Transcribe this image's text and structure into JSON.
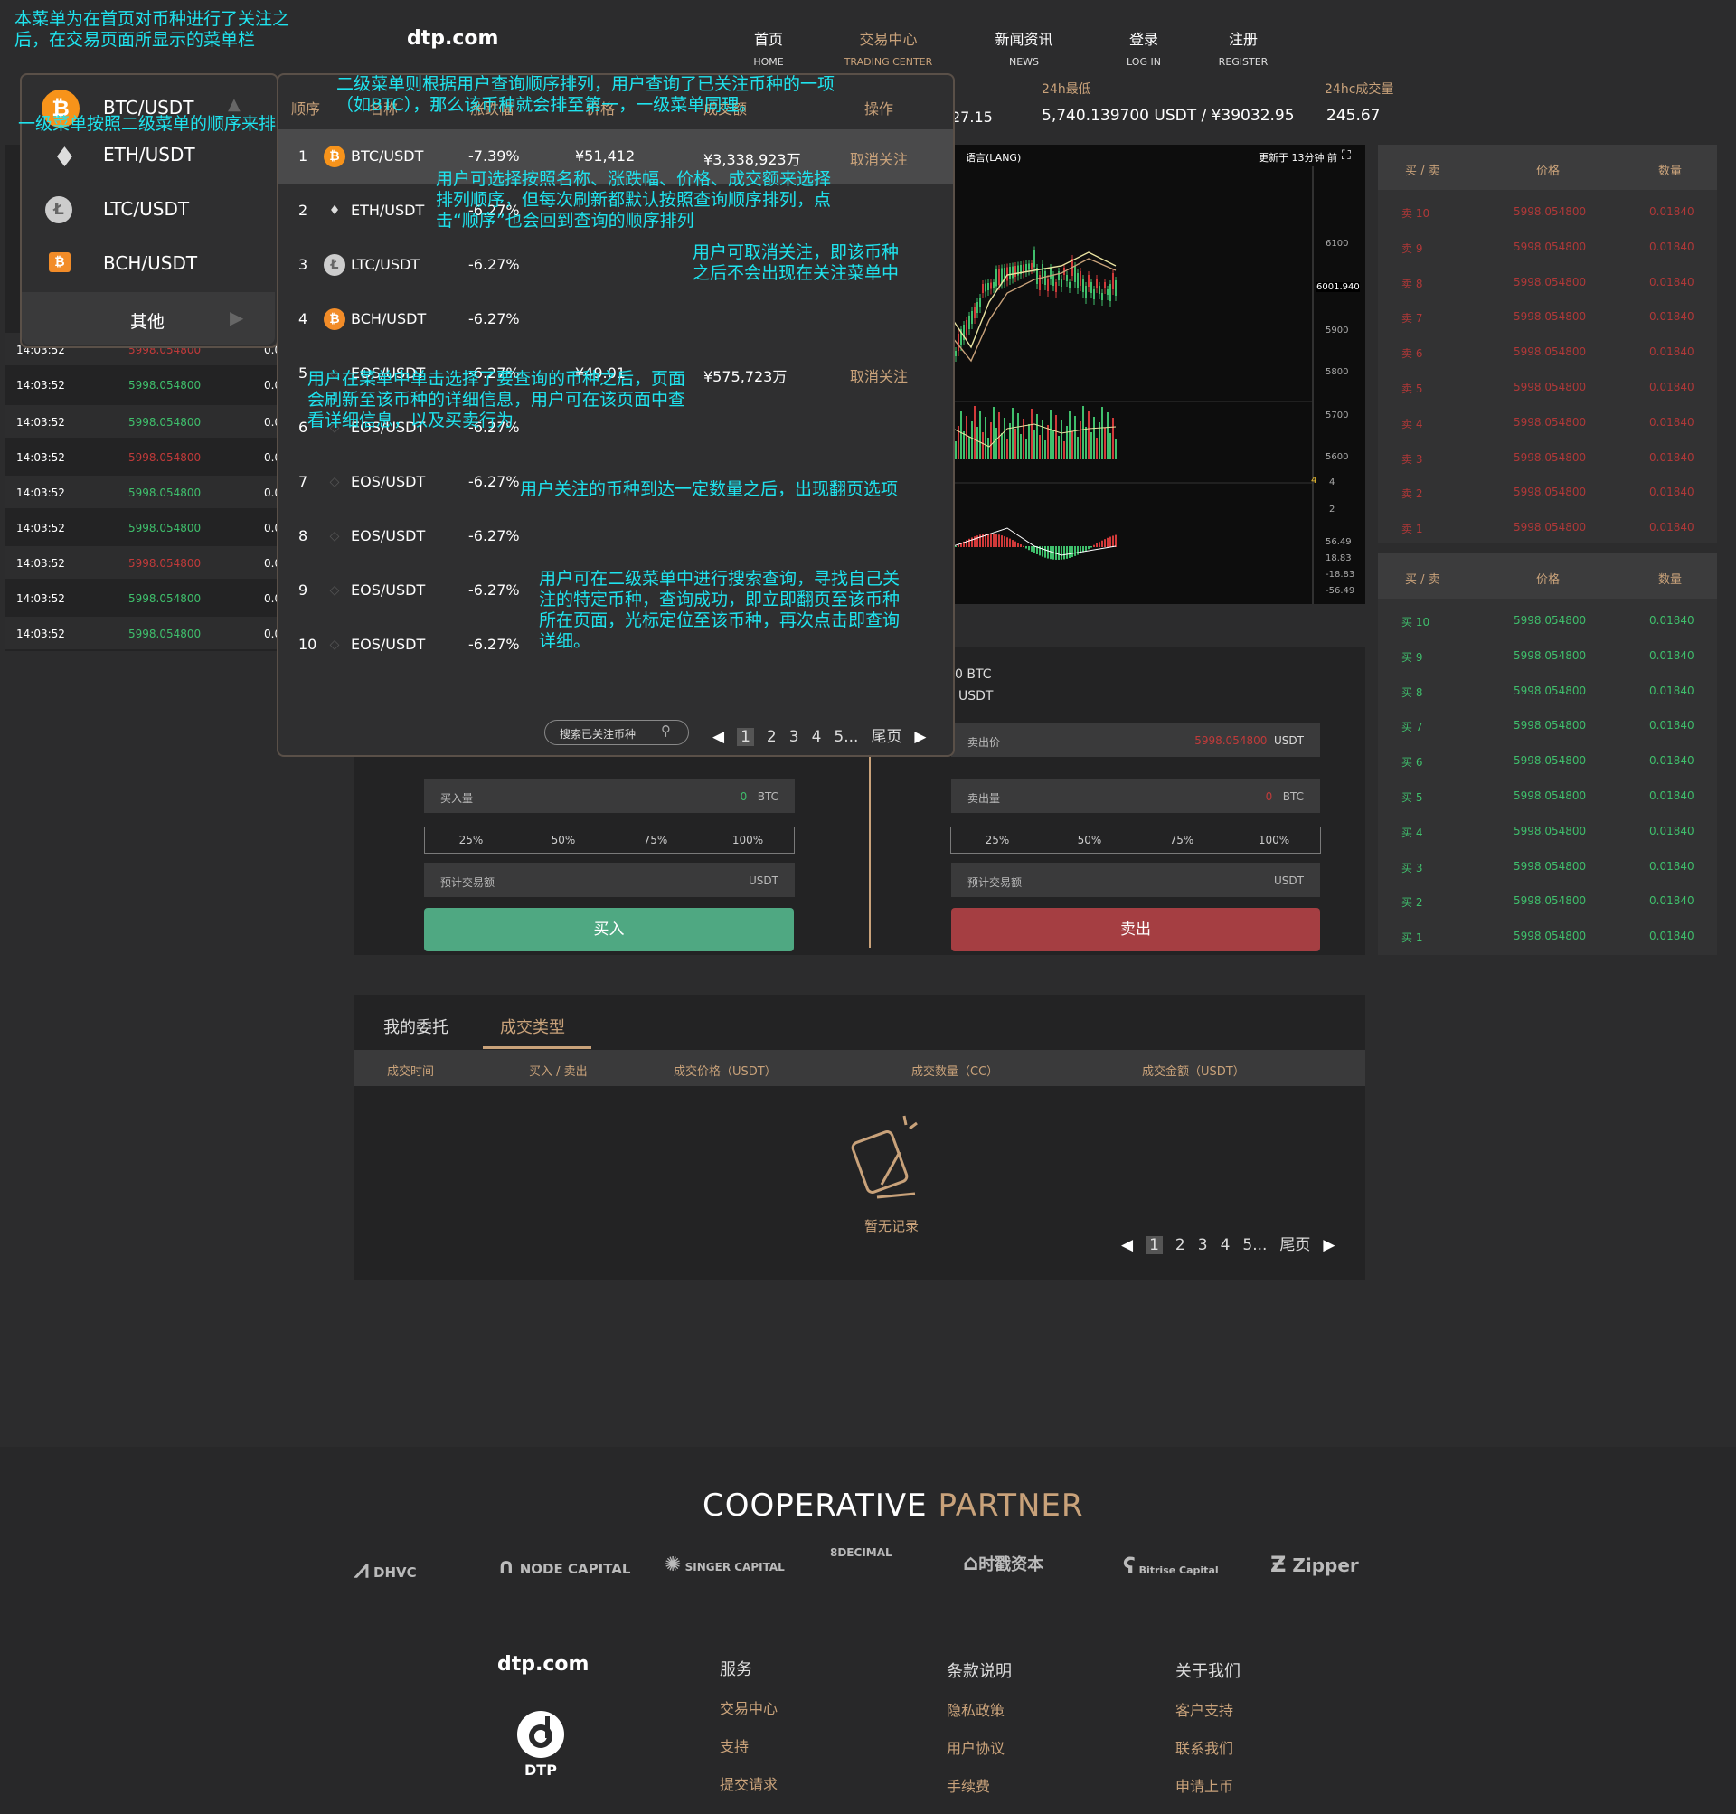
{
  "annotations": {
    "menu_intro": "本菜单为在首页对币种进行了关注之后，在交易页面所显示的菜单栏",
    "level1_order": "一级菜单按照二级菜单的顺序来排",
    "level2_order": "二级菜单则根据用户查询顺序排列，用户查询了已关注币种的一项（如BTC），那么该币种就会排至第一，一级菜单同理。",
    "sort_options": "用户可选择按照名称、涨跌幅、价格、成交额来选择排列顺序，但每次刷新都默认按照查询顺序排列，点击“顺序”也会回到查询的顺序排列",
    "unfollow": "用户可取消关注，即该币种之后不会出现在关注菜单中",
    "click_select": "用户在菜单中单击选择了要查询的币种之后，页面会刷新至该币种的详细信息，用户可在该页面中查看详细信息，以及买卖行为",
    "pagination": "用户关注的币种到达一定数量之后，出现翻页选项",
    "search": "用户可在二级菜单中进行搜索查询，寻找自己关注的特定币种，查询成功，即立即翻页至该币种所在页面，光标定位至该币种，再次点击即查询详细。"
  },
  "header": {
    "logo": "dtp.com",
    "nav": [
      {
        "cn": "首页",
        "en": "HOME"
      },
      {
        "cn": "交易中心",
        "en": "TRADING CENTER"
      },
      {
        "cn": "新闻资讯",
        "en": "NEWS"
      },
      {
        "cn": "登录",
        "en": "LOG IN"
      },
      {
        "cn": "注册",
        "en": "REGISTER"
      }
    ]
  },
  "ticker": {
    "partial_value": "27.15",
    "low_label": "24h最低",
    "low_value": "5,740.139700 USDT / ¥39032.95",
    "volume_label": "24hc成交量",
    "volume_value": "245.67"
  },
  "menu1": {
    "items": [
      "BTC/USDT",
      "ETH/USDT",
      "LTC/USDT",
      "BCH/USDT"
    ],
    "other": "其他"
  },
  "menu2": {
    "headers": [
      "顺序",
      "名称",
      "涨跌幅",
      "价格",
      "成交额",
      "操作"
    ],
    "rows": [
      {
        "n": "1",
        "name": "BTC/USDT",
        "chg": "-7.39%",
        "price": "¥51,412",
        "amt": "¥3,338,923万",
        "op": "取消关注"
      },
      {
        "n": "2",
        "name": "ETH/USDT",
        "chg": "-6.27%",
        "price": "",
        "amt": "",
        "op": ""
      },
      {
        "n": "3",
        "name": "LTC/USDT",
        "chg": "-6.27%",
        "price": "",
        "amt": "",
        "op": ""
      },
      {
        "n": "4",
        "name": "BCH/USDT",
        "chg": "-6.27%",
        "price": "",
        "amt": "",
        "op": ""
      },
      {
        "n": "5",
        "name": "EOS/USDT",
        "chg": "-6.27%",
        "price": "¥49.01",
        "amt": "¥575,723万",
        "op": "取消关注"
      },
      {
        "n": "6",
        "name": "EOS/USDT",
        "chg": "-6.27%",
        "price": "",
        "amt": "",
        "op": ""
      },
      {
        "n": "7",
        "name": "EOS/USDT",
        "chg": "-6.27%",
        "price": "",
        "amt": "",
        "op": ""
      },
      {
        "n": "8",
        "name": "EOS/USDT",
        "chg": "-6.27%",
        "price": "",
        "amt": "",
        "op": ""
      },
      {
        "n": "9",
        "name": "EOS/USDT",
        "chg": "-6.27%",
        "price": "",
        "amt": "",
        "op": ""
      },
      {
        "n": "10",
        "name": "EOS/USDT",
        "chg": "-6.27%",
        "price": "",
        "amt": "",
        "op": ""
      }
    ],
    "search_placeholder": "搜索已关注币种",
    "pages": [
      "1",
      "2",
      "3",
      "4",
      "5..."
    ],
    "last": "尾页"
  },
  "trades": {
    "time": "14:03:52",
    "price": "5998.054800",
    "amount": "0.0"
  },
  "chart": {
    "lang": "语言(LANG)",
    "updated": "更新于 13分钟 前",
    "price_ticks": [
      "6100",
      "6001.940",
      "5900",
      "5800",
      "5700",
      "5600"
    ],
    "vol_ticks": [
      "4",
      "4",
      "2"
    ],
    "macd_ticks": [
      "56.49",
      "18.83",
      "-18.83",
      "-56.49"
    ]
  },
  "orderbook": {
    "header": [
      "买 / 卖",
      "价格",
      "数量"
    ],
    "sell_labels": [
      "卖 10",
      "卖 9",
      "卖 8",
      "卖 7",
      "卖 6",
      "卖 5",
      "卖 4",
      "卖 3",
      "卖 2",
      "卖 1"
    ],
    "buy_labels": [
      "买 10",
      "买 9",
      "买 8",
      "买 7",
      "买 6",
      "买 5",
      "买 4",
      "买 3",
      "买 2",
      "买 1"
    ],
    "price": "5998.054800",
    "qty": "0.01840"
  },
  "trade_form": {
    "balance_btc": "0 BTC",
    "balance_usdt": "USDT",
    "sell_price_label": "卖出价",
    "sell_price_value": "5998.054800",
    "unit_usdt": "USDT",
    "buy_amount_label": "买入量",
    "sell_amount_label": "卖出量",
    "zero": "0",
    "unit_btc": "BTC",
    "pcts": [
      "25%",
      "50%",
      "75%",
      "100%"
    ],
    "est_label": "预计交易额",
    "buy_btn": "买入",
    "sell_btn": "卖出"
  },
  "orders": {
    "tabs": [
      "我的委托",
      "成交类型"
    ],
    "columns": [
      "成交时间",
      "买入 / 卖出",
      "成交价格（USDT）",
      "成交数量（CC）",
      "成交金额（USDT）"
    ],
    "empty": "暂无记录",
    "pages": [
      "1",
      "2",
      "3",
      "4",
      "5..."
    ],
    "last": "尾页"
  },
  "footer": {
    "coop_a": "COOPERATIVE",
    "coop_b": "PARTNER",
    "partners": [
      "DHVC",
      "NODE CAPITAL",
      "SINGER CAPITAL",
      "8DECIMAL",
      "时戳资本",
      "Bitrise Capital",
      "Zipper"
    ],
    "logo": "dtp.com",
    "logo_sub": "DTP",
    "cols": [
      {
        "h": "服务",
        "links": [
          "交易中心",
          "支持",
          "提交请求"
        ]
      },
      {
        "h": "条款说明",
        "links": [
          "隐私政策",
          "用户协议",
          "手续费"
        ]
      },
      {
        "h": "关于我们",
        "links": [
          "客户支持",
          "联系我们",
          "申请上币"
        ]
      }
    ]
  },
  "colors": {
    "accent": "#c9a27a",
    "buy": "#4fa882",
    "sell": "#a53e42",
    "annotation": "#1fe3ee"
  }
}
